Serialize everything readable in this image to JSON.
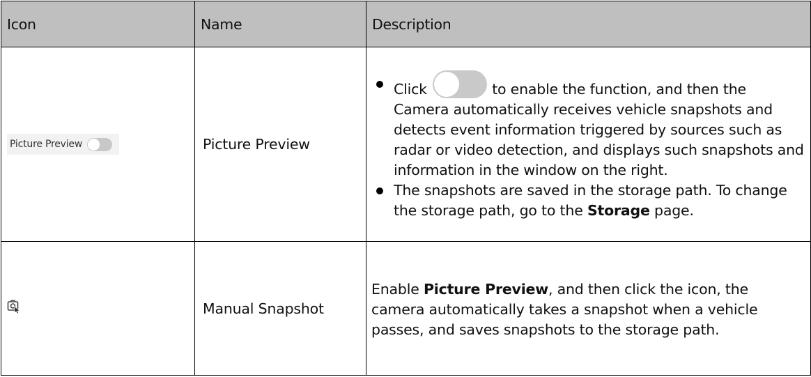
{
  "table": {
    "headers": [
      "Icon",
      "Name",
      "Description"
    ],
    "header_bg": "#bfbfbf",
    "rows": [
      {
        "icon": {
          "widget_label": "Picture Preview",
          "widget_name": "picture-preview-toggle-icon"
        },
        "name": "Picture Preview",
        "description": {
          "bullet1": {
            "before_toggle": "Click",
            "toggle_icon": "toggle-switch-off-icon",
            "after_toggle": "to enable the function, and then the Camera automatically receives vehicle snapshots and detects event information triggered by sources such as radar or video detection, and displays such snapshots and information in the window on the right."
          },
          "bullet2": {
            "text_before": "The snapshots are saved in the storage path. To change the storage path, go to the",
            "bold": "Storage",
            "text_after": "page."
          }
        }
      },
      {
        "icon": {
          "widget_name": "manual-snapshot-icon"
        },
        "name": "Manual Snapshot",
        "description": {
          "text_before": "Enable",
          "bold": "Picture Preview",
          "text_after": ", and then click the icon, the camera automatically takes a snapshot when a vehicle passes, and saves snapshots to the storage path."
        }
      }
    ]
  }
}
